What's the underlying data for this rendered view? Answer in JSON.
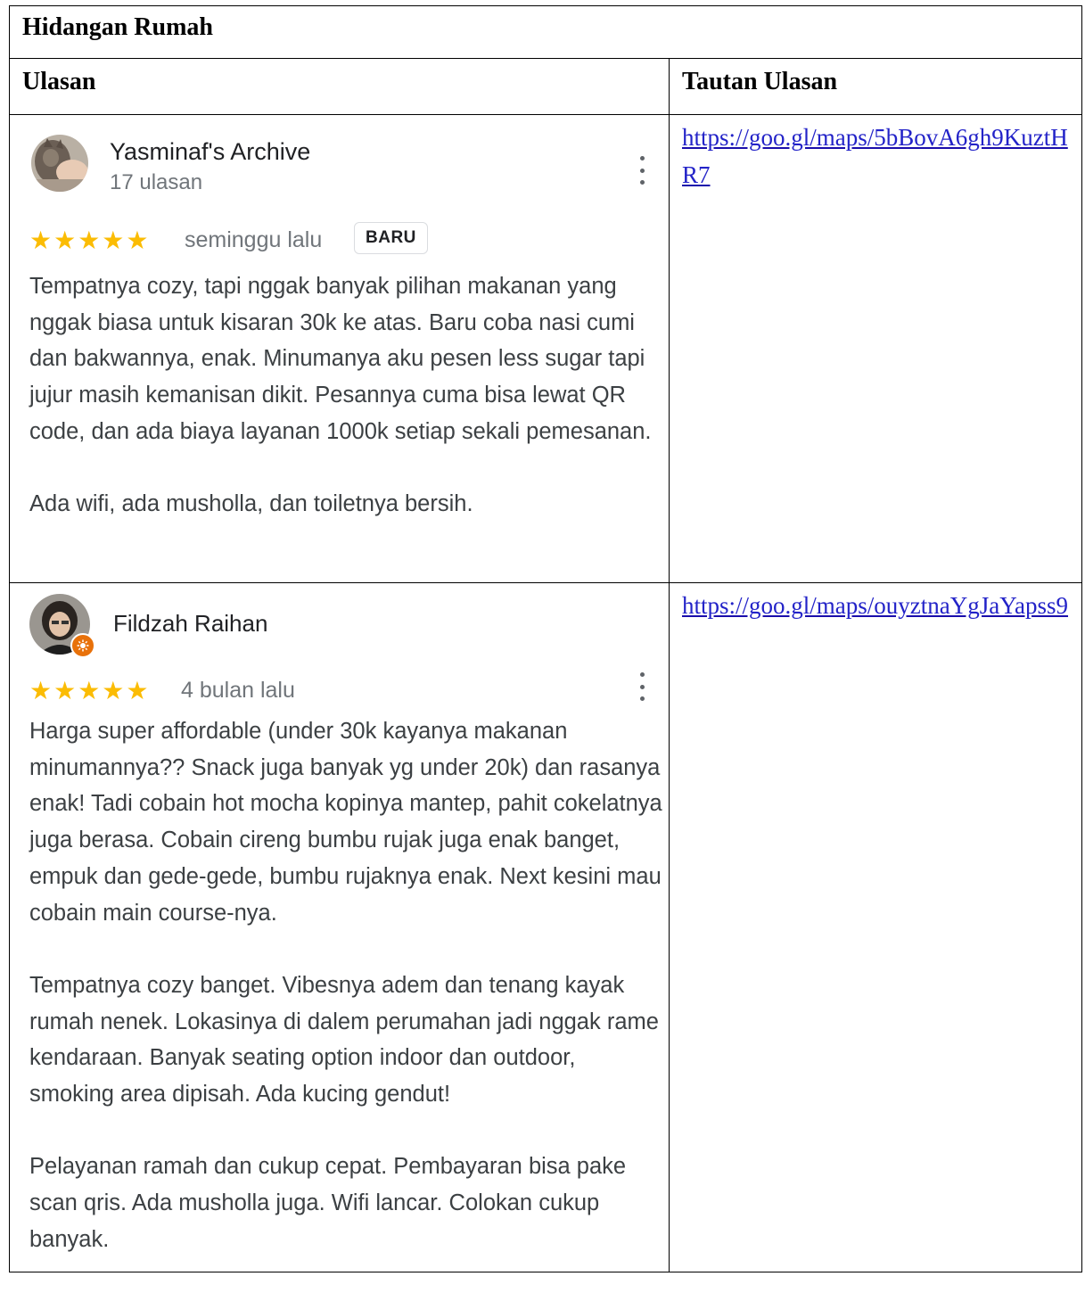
{
  "table": {
    "title": "Hidangan Rumah",
    "headers": [
      "Ulasan",
      "Tautan Ulasan"
    ]
  },
  "reviews": [
    {
      "author": "Yasminaf's Archive",
      "review_count": "17 ulasan",
      "rating": 5,
      "stars": "★★★★★",
      "time": "seminggu lalu",
      "badge": "BARU",
      "paragraphs": [
        "Tempatnya cozy, tapi nggak banyak pilihan makanan yang nggak biasa untuk kisaran 30k ke atas. Baru coba nasi cumi dan bakwannya, enak. Minumanya aku pesen less sugar tapi jujur masih kemanisan dikit. Pesannya cuma bisa lewat QR code, dan ada biaya layanan 1000k setiap sekali pemesanan.",
        "Ada wifi, ada musholla, dan toiletnya bersih."
      ],
      "link": "https://goo.gl/maps/5bBovA6gh9KuztHR7"
    },
    {
      "author": "Fildzah Raihan",
      "rating": 5,
      "stars": "★★★★★",
      "time": "4 bulan lalu",
      "paragraphs": [
        "Harga super affordable (under 30k kayanya makanan minumannya?? Snack juga banyak yg under 20k) dan rasanya enak! Tadi cobain hot mocha kopinya mantep, pahit cokelatnya juga berasa. Cobain cireng bumbu rujak juga enak banget, empuk dan gede-gede, bumbu rujaknya enak. Next kesini mau cobain main course-nya.",
        "Tempatnya cozy banget. Vibesnya adem dan tenang kayak rumah nenek. Lokasinya di dalem perumahan jadi nggak rame kendaraan. Banyak seating option indoor dan outdoor, smoking area dipisah. Ada kucing gendut!",
        "Pelayanan ramah dan cukup cepat. Pembayaran bisa pake scan qris. Ada musholla juga. Wifi lancar. Colokan cukup banyak."
      ],
      "link": "https://goo.gl/maps/ouyztnaYgJaYapss9"
    }
  ],
  "icons": {
    "more": "more-vert-icon",
    "local_guide": "local-guide-badge-icon"
  },
  "colors": {
    "star": "#fbbc04",
    "link": "#2323c8",
    "local_guide_badge": "#e8710a"
  }
}
